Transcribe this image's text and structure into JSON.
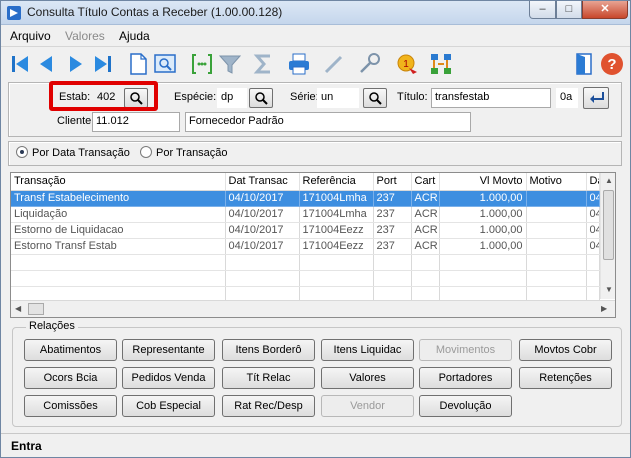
{
  "window": {
    "title": "Consulta Título Contas a Receber (1.00.00.128)",
    "min_label": "–",
    "max_label": "□",
    "close_label": "✕"
  },
  "menu": [
    {
      "label": "Arquivo",
      "disabled": false
    },
    {
      "label": "Valores",
      "disabled": true
    },
    {
      "label": "Ajuda",
      "disabled": false
    }
  ],
  "toolbar": {
    "icons": [
      "first-icon",
      "previous-icon",
      "next-icon",
      "last-icon",
      "document-icon",
      "zoom-window-icon",
      "goto-icon",
      "filter-icon",
      "sum-icon",
      "print-icon",
      "edit-icon",
      "key-icon",
      "reference-icon",
      "structure-icon",
      "exit-icon",
      "help-icon"
    ]
  },
  "filters": {
    "estab_label": "Estab:",
    "estab_value": "402",
    "especie_label": "Espécie:",
    "especie_value": "dp",
    "serie_label": "Série:",
    "serie_value": "un",
    "titulo_label": "Título:",
    "titulo_value": "transfestab",
    "parcela_value": "0a",
    "cliente_label": "Cliente:",
    "cliente_value": "11.012",
    "cliente_nome": "Fornecedor Padrão"
  },
  "order": {
    "option1": "Por Data Transação",
    "option2": "Por Transação",
    "selected": 1
  },
  "grid": {
    "columns": [
      "Transação",
      "Dat Transac",
      "Referência",
      "Port",
      "Cart",
      "Vl Movto",
      "Motivo",
      "Da"
    ],
    "rows": [
      [
        "Transf Estabelecimento",
        "04/10/2017",
        "171004Lmha",
        "237",
        "ACR",
        "1.000,00",
        "",
        "04"
      ],
      [
        "Liquidação",
        "04/10/2017",
        "171004Lmha",
        "237",
        "ACR",
        "1.000,00",
        "",
        "04"
      ],
      [
        "Estorno de Liquidacao",
        "04/10/2017",
        "171004Eezz",
        "237",
        "ACR",
        "1.000,00",
        "",
        "04"
      ],
      [
        "Estorno Transf Estab",
        "04/10/2017",
        "171004Eezz",
        "237",
        "ACR",
        "1.000,00",
        "",
        "04"
      ]
    ],
    "selected_row": 0,
    "up_arrow": "▲",
    "down_arrow": "▼",
    "left_arrow": "◀",
    "right_arrow": "▶"
  },
  "relations": {
    "title": "Relações",
    "buttons": [
      {
        "label": "Abatimentos",
        "enabled": true
      },
      {
        "label": "Representante",
        "enabled": true
      },
      {
        "label": "Itens Borderô",
        "enabled": true
      },
      {
        "label": "Itens Liquidac",
        "enabled": true
      },
      {
        "label": "Movimentos",
        "enabled": false
      },
      {
        "label": "Movtos Cobr",
        "enabled": true
      },
      {
        "label": "Ocors Bcia",
        "enabled": true
      },
      {
        "label": "Pedidos Venda",
        "enabled": true
      },
      {
        "label": "Tít  Relac",
        "enabled": true
      },
      {
        "label": "Valores",
        "enabled": true
      },
      {
        "label": "Portadores",
        "enabled": true
      },
      {
        "label": "Retenções",
        "enabled": true
      },
      {
        "label": "Comissões",
        "enabled": true
      },
      {
        "label": "Cob Especial",
        "enabled": true
      },
      {
        "label": "Rat Rec/Desp",
        "enabled": true
      },
      {
        "label": "Vendor",
        "enabled": false
      },
      {
        "label": "Devolução",
        "enabled": true
      }
    ]
  },
  "status": {
    "text": "Entra"
  }
}
